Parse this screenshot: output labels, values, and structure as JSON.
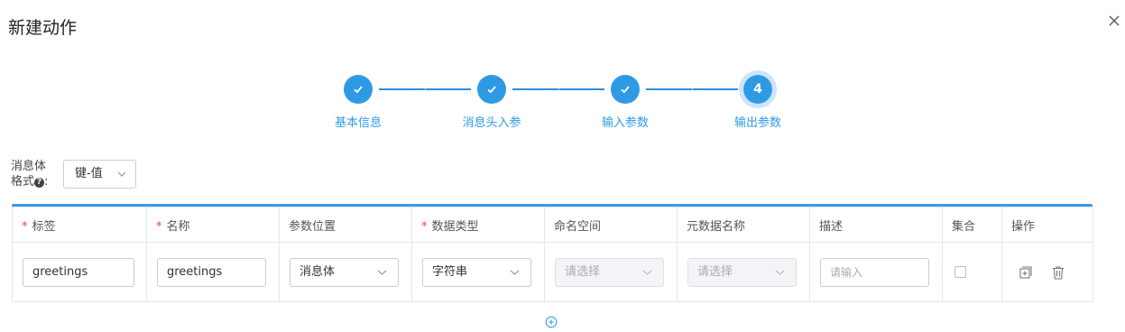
{
  "dialog": {
    "title": "新建动作"
  },
  "steps": [
    {
      "label": "基本信息",
      "status": "done"
    },
    {
      "label": "消息头入参",
      "status": "done"
    },
    {
      "label": "输入参数",
      "status": "done"
    },
    {
      "label": "输出参数",
      "status": "current",
      "number": "4"
    }
  ],
  "format": {
    "label_line1": "消息体",
    "label_line2": "格式",
    "colon": ":",
    "value": "键-值"
  },
  "table": {
    "headers": {
      "tag": "标签",
      "name": "名称",
      "position": "参数位置",
      "data_type": "数据类型",
      "namespace": "命名空间",
      "meta_name": "元数据名称",
      "desc": "描述",
      "collection": "集合",
      "ops": "操作"
    },
    "required_mark": "*",
    "rows": [
      {
        "tag": "greetings",
        "name": "greetings",
        "position": "消息体",
        "data_type": "字符串",
        "namespace_placeholder": "请选择",
        "meta_placeholder": "请选择",
        "desc_placeholder": "请输入"
      }
    ]
  },
  "colors": {
    "accent": "#2f9ae4",
    "required": "#e24646"
  }
}
